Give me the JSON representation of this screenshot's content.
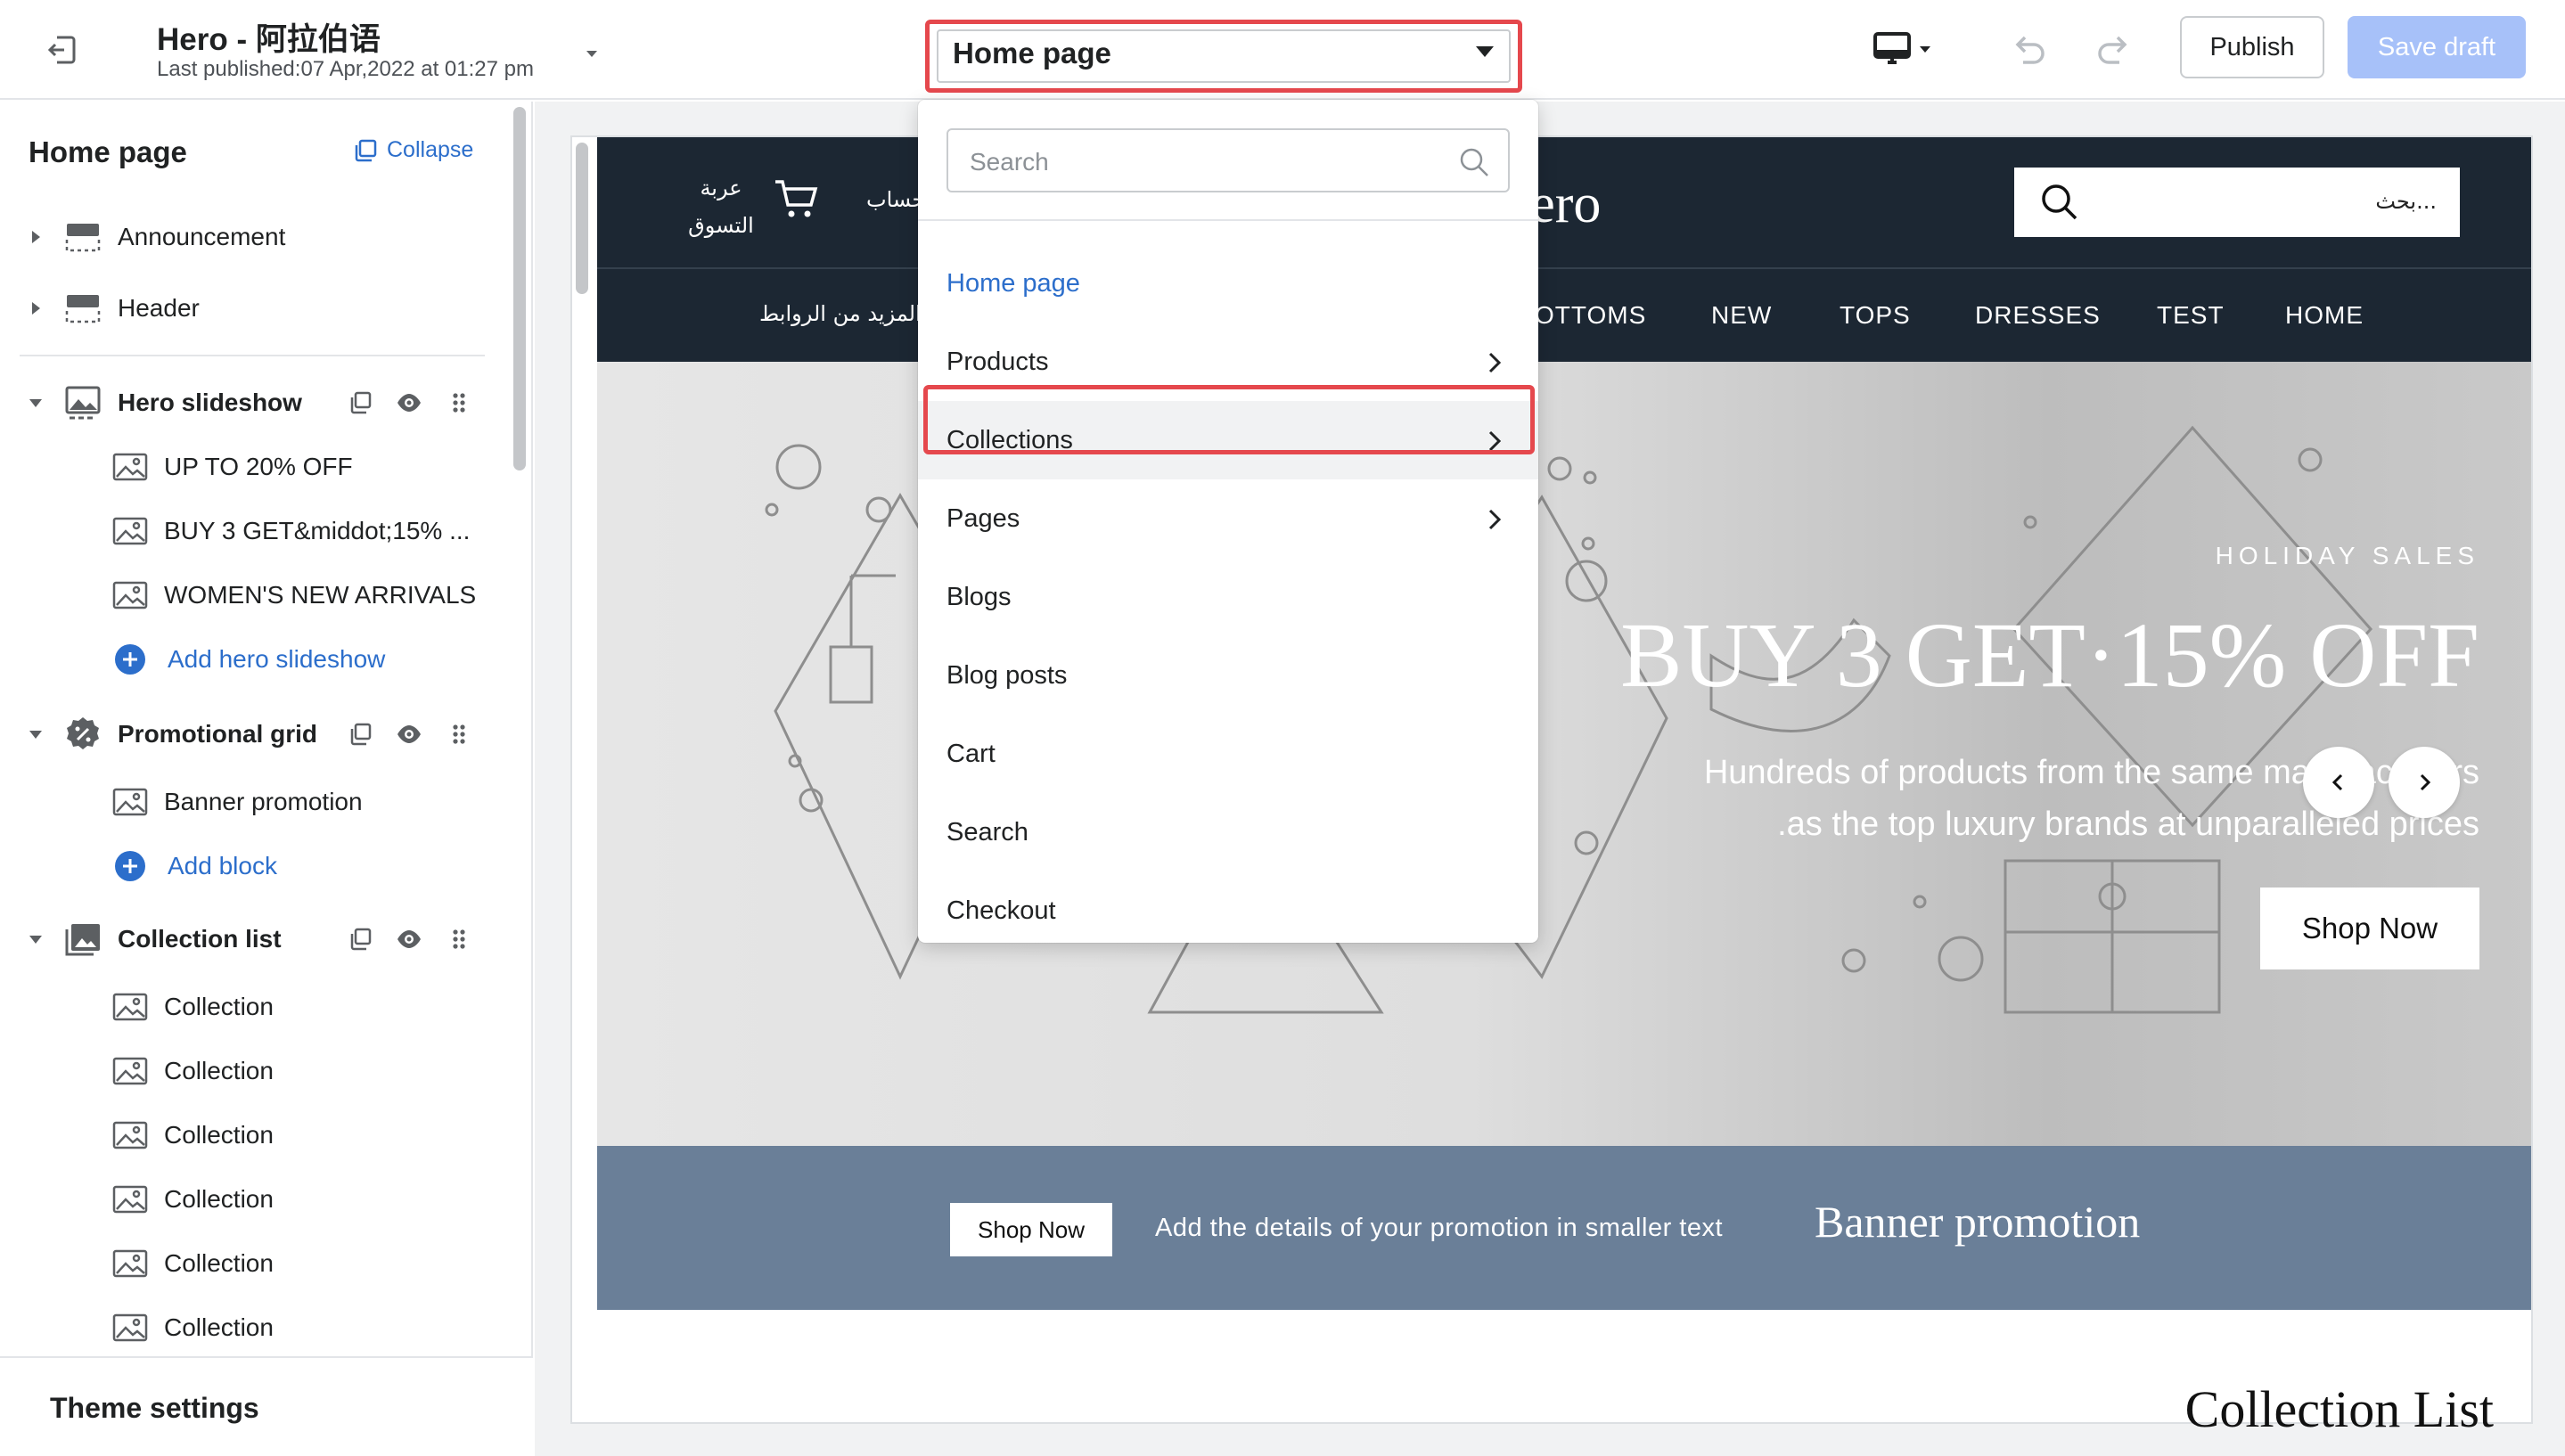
{
  "topbar": {
    "theme_name": "Hero - 阿拉伯语",
    "last_published": "Last published:07 Apr,2022 at 01:27 pm",
    "page_selector": "Home page",
    "publish_label": "Publish",
    "save_label": "Save draft"
  },
  "sidebar": {
    "title": "Home page",
    "collapse_label": "Collapse",
    "sections": {
      "announcement": "Announcement",
      "header": "Header",
      "hero_slideshow": "Hero slideshow",
      "promotional_grid": "Promotional grid",
      "collection_list": "Collection list"
    },
    "hero_blocks": [
      "UP TO 20% OFF",
      "BUY 3 GET&middot;15% ...",
      "WOMEN'S NEW ARRIVALS"
    ],
    "add_hero": "Add hero slideshow",
    "promo_blocks": [
      "Banner promotion"
    ],
    "add_block": "Add block",
    "collection_blocks": [
      "Collection",
      "Collection",
      "Collection",
      "Collection",
      "Collection",
      "Collection"
    ],
    "theme_settings": "Theme settings"
  },
  "dropdown": {
    "search_placeholder": "Search",
    "items": [
      "Home page",
      "Products",
      "Collections",
      "Pages",
      "Blogs",
      "Blog posts",
      "Cart",
      "Search",
      "Checkout"
    ]
  },
  "store": {
    "cart_line1": "عربة",
    "cart_line2": "التسوق",
    "account": "حساب",
    "brand": "lero",
    "search_placeholder": "بحث...",
    "nav_more": "المزيد من الروابط",
    "nav": [
      "OTTOMS",
      "NEW",
      "TOPS",
      "DRESSES",
      "TEST",
      "HOME"
    ],
    "hero": {
      "eyebrow": "HOLIDAY SALES",
      "title": "BUY 3 GET·15% OFF",
      "sub1": "Hundreds of products from the same manufacturers",
      "sub2": ".as the top luxury brands at unparalleled prices",
      "cta": "Shop Now"
    },
    "banner": {
      "button": "Shop Now",
      "text": "Add the details of your promotion in smaller text",
      "title": "Banner promotion"
    },
    "collection_list_title": "Collection List"
  },
  "colors": {
    "accent": "#2c6ecb",
    "highlight": "#e5484d",
    "store_dark": "#1c2733",
    "banner": "#6a7f98",
    "save_disabled": "#a7c1f9"
  }
}
